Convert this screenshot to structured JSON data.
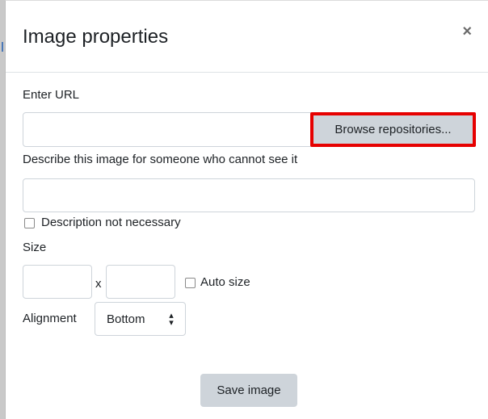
{
  "dialog": {
    "title": "Image properties",
    "close_icon": "×"
  },
  "url": {
    "label": "Enter URL",
    "value": "",
    "browse_label": "Browse repositories..."
  },
  "description": {
    "label": "Describe this image for someone who cannot see it",
    "value": "",
    "not_necessary_label": "Description not necessary",
    "not_necessary_checked": false
  },
  "size": {
    "label": "Size",
    "width_value": "",
    "height_value": "",
    "separator": "x",
    "auto_label": "Auto size",
    "auto_checked": false
  },
  "alignment": {
    "label": "Alignment",
    "selected": "Bottom",
    "arrow_icon": "updown-chevron-icon"
  },
  "actions": {
    "save_label": "Save image"
  },
  "colors": {
    "highlight_border": "#e60000",
    "button_bg": "#ced4da",
    "input_border": "#ced4da"
  }
}
